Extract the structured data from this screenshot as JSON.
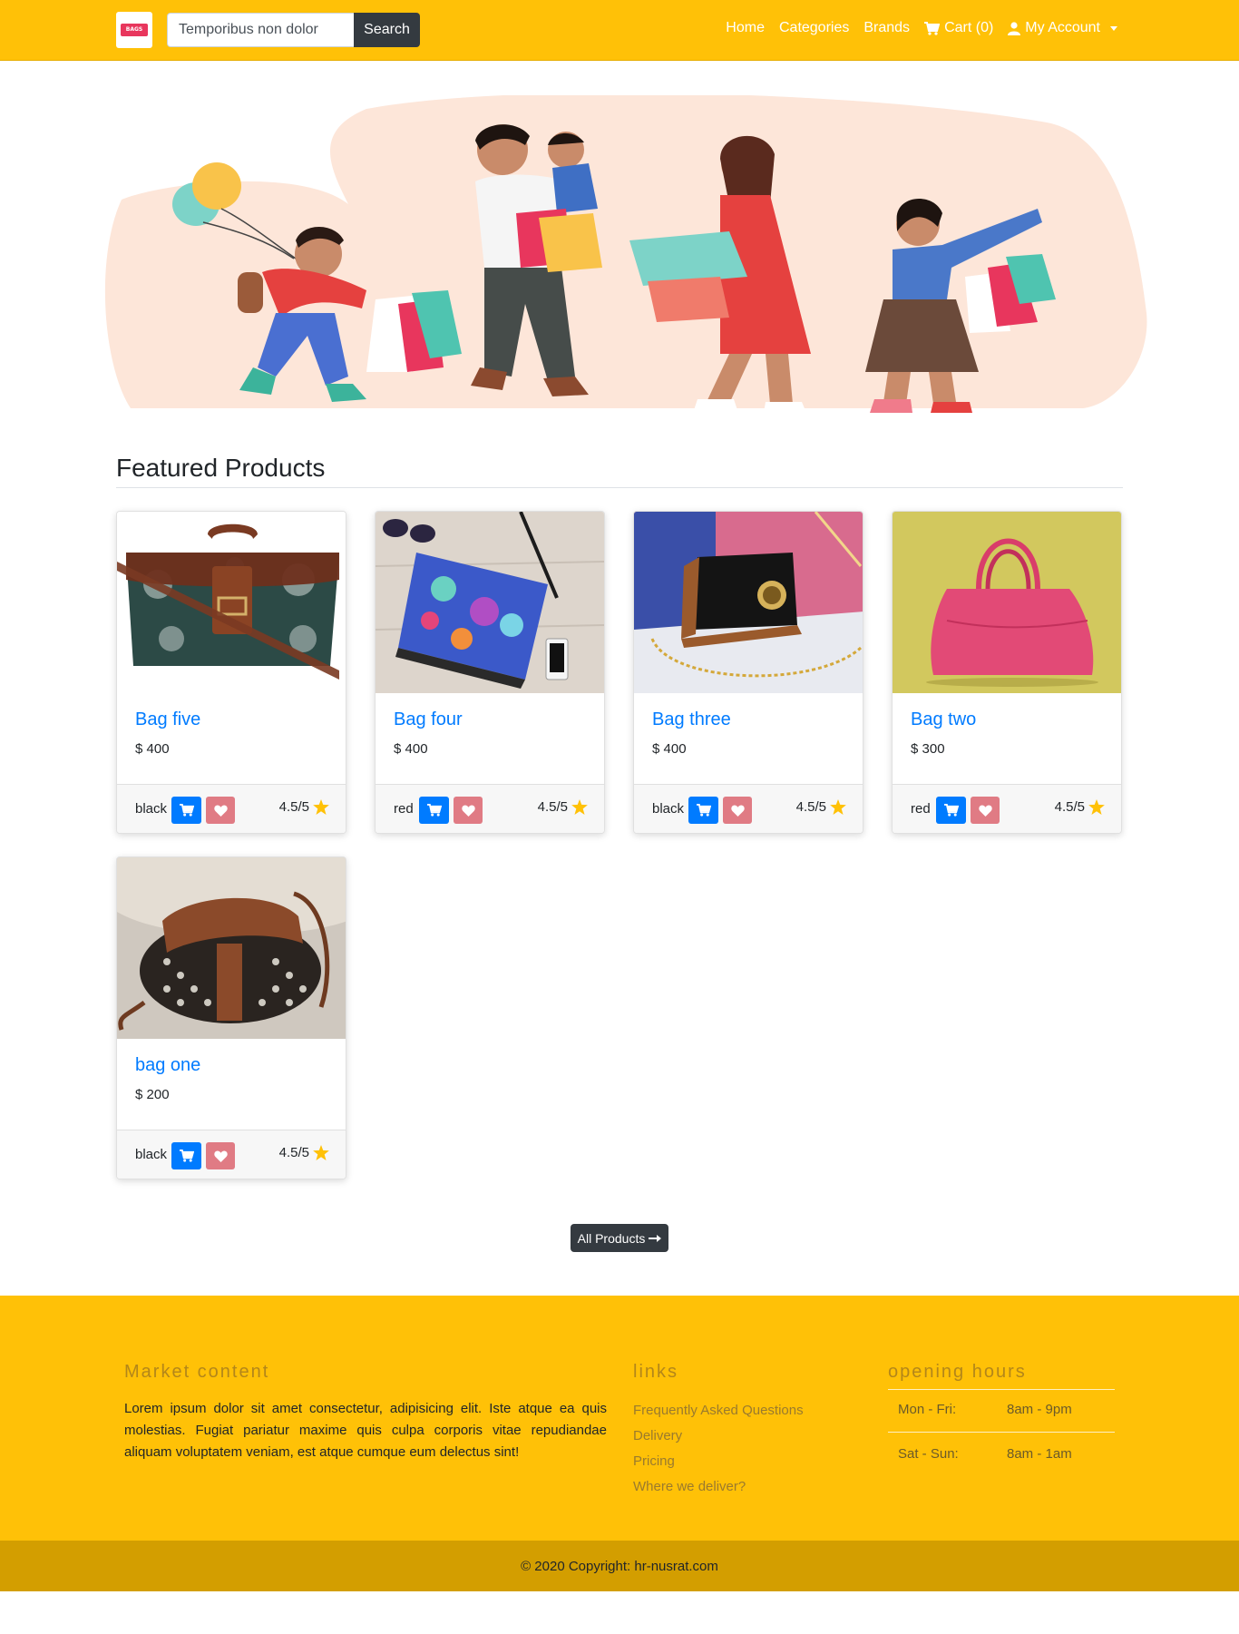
{
  "nav": {
    "search": {
      "value": "Temporibus non dolor",
      "button": "Search"
    },
    "links": [
      {
        "label": "Home",
        "icon": ""
      },
      {
        "label": "Categories",
        "icon": ""
      },
      {
        "label": "Brands",
        "icon": ""
      },
      {
        "label": "Cart (0)",
        "icon": "cart-icon"
      },
      {
        "label": "My Account",
        "icon": "user-icon"
      }
    ]
  },
  "featured": {
    "title": "Featured Products",
    "products": [
      {
        "name": "Bag five",
        "price": "$ 400",
        "color": "black",
        "rating": "4.5/5"
      },
      {
        "name": "Bag four",
        "price": "$ 400",
        "color": "red",
        "rating": "4.5/5"
      },
      {
        "name": "Bag three",
        "price": "$ 400",
        "color": "black",
        "rating": "4.5/5"
      },
      {
        "name": "Bag two",
        "price": "$ 300",
        "color": "red",
        "rating": "4.5/5"
      },
      {
        "name": "bag one",
        "price": "$ 200",
        "color": "black",
        "rating": "4.5/5"
      }
    ],
    "all_button": "All Products"
  },
  "footer": {
    "market": {
      "title": "Market content",
      "text": "Lorem ipsum dolor sit amet consectetur, adipisicing elit. Iste atque ea quis molestias. Fugiat pariatur maxime quis culpa corporis vitae repudiandae aliquam voluptatem veniam, est atque cumque eum delectus sint!"
    },
    "links": {
      "title": "links",
      "items": [
        "Frequently Asked Questions",
        "Delivery",
        "Pricing",
        "Where we deliver?"
      ]
    },
    "hours": {
      "title": "opening hours",
      "rows": [
        {
          "days": "Mon - Fri:",
          "time": "8am - 9pm"
        },
        {
          "days": "Sat - Sun:",
          "time": "8am - 1am"
        }
      ]
    },
    "copyright": "© 2020 Copyright: hr-nusrat.com"
  },
  "colors": {
    "navbar": "#ffc107",
    "primary": "#007bff",
    "dark": "#343a40",
    "favorite": "#e07b84",
    "star": "#ffc107"
  }
}
